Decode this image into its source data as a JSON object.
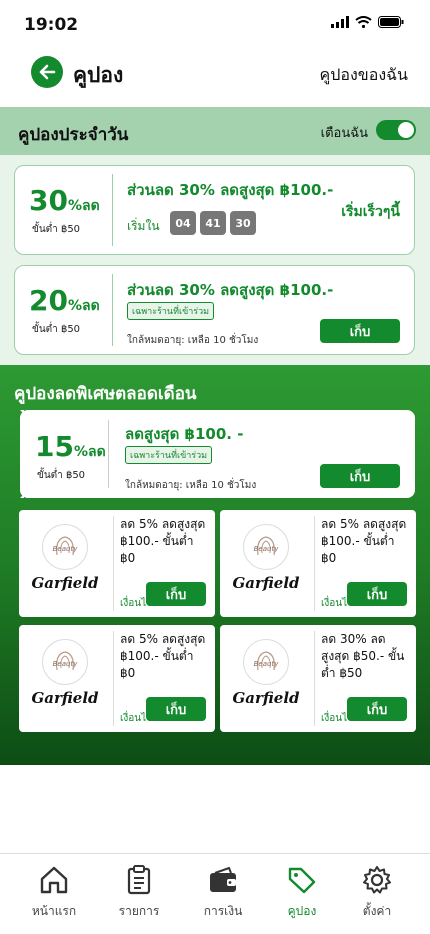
{
  "status": {
    "time": "19:02"
  },
  "header": {
    "title": "คูปอง",
    "my_coupons": "คูปองของฉัน"
  },
  "daily": {
    "title": "คูปองประจำวัน",
    "notify_label": "เตือนฉัน",
    "notify_on": true,
    "cards": [
      {
        "pct": "30",
        "unit": "%ลด",
        "min": "ขั้นต่ำ ฿50",
        "title": "ส่วนลด 30% ลดสูงสุด ฿100.-",
        "starts_in_label": "เริ่มใน",
        "timer": [
          "04",
          "41",
          "30"
        ],
        "status": "เริ่มเร็วๆนี้"
      },
      {
        "pct": "20",
        "unit": "%ลด",
        "min": "ขั้นต่ำ ฿50",
        "title": "ส่วนลด 30% ลดสูงสุด ฿100.-",
        "tag": "เฉพาะร้านที่เข้าร่วม",
        "expire": "ใกล้หมดอายุ: เหลือ 10 ชั่วโมง",
        "button": "เก็บ"
      }
    ]
  },
  "monthly": {
    "title": "คูปองลดพิเศษตลอดเดือน",
    "featured": {
      "pct": "15",
      "unit": "%ลด",
      "min": "ขั้นต่ำ ฿50",
      "title": "ลดสูงสุด ฿100. -",
      "tag": "เฉพาะร้านที่เข้าร่วม",
      "expire": "ใกล้หมดอายุ: เหลือ 10 ชั่วโมง",
      "button": "เก็บ"
    },
    "coupons": [
      {
        "brand": "Garfield",
        "logo_text": "Beauty",
        "desc": "ลด 5% ลดสูงสุด ฿100.- ขั้นต่ำ ฿0",
        "cond": "เงื่อนไข",
        "button": "เก็บ"
      },
      {
        "brand": "Garfield",
        "logo_text": "Beauty",
        "desc": "ลด 5% ลดสูงสุด ฿100.- ขั้นต่ำ ฿0",
        "cond": "เงื่อนไข",
        "button": "เก็บ"
      },
      {
        "brand": "Garfield",
        "logo_text": "Beauty",
        "desc": "ลด 5% ลดสูงสุด ฿100.- ขั้นต่ำ ฿0",
        "cond": "เงื่อนไข",
        "button": "เก็บ"
      },
      {
        "brand": "Garfield",
        "logo_text": "Beauty",
        "desc": "ลด 30% ลดสูงสุด ฿50.- ขั้นต่ำ ฿50",
        "cond": "เงื่อนไข",
        "button": "เก็บ"
      }
    ]
  },
  "tabbar": {
    "items": [
      {
        "label": "หน้าแรก",
        "icon": "home-icon"
      },
      {
        "label": "รายการ",
        "icon": "clipboard-icon"
      },
      {
        "label": "การเงิน",
        "icon": "wallet-icon"
      },
      {
        "label": "คูปอง",
        "icon": "tag-icon",
        "active": true
      },
      {
        "label": "ตั้งค่า",
        "icon": "gear-icon"
      }
    ]
  },
  "colors": {
    "primary": "#138a2e",
    "light": "#a5d2ae",
    "bg": "#e8f3ea",
    "timer": "#777777"
  }
}
